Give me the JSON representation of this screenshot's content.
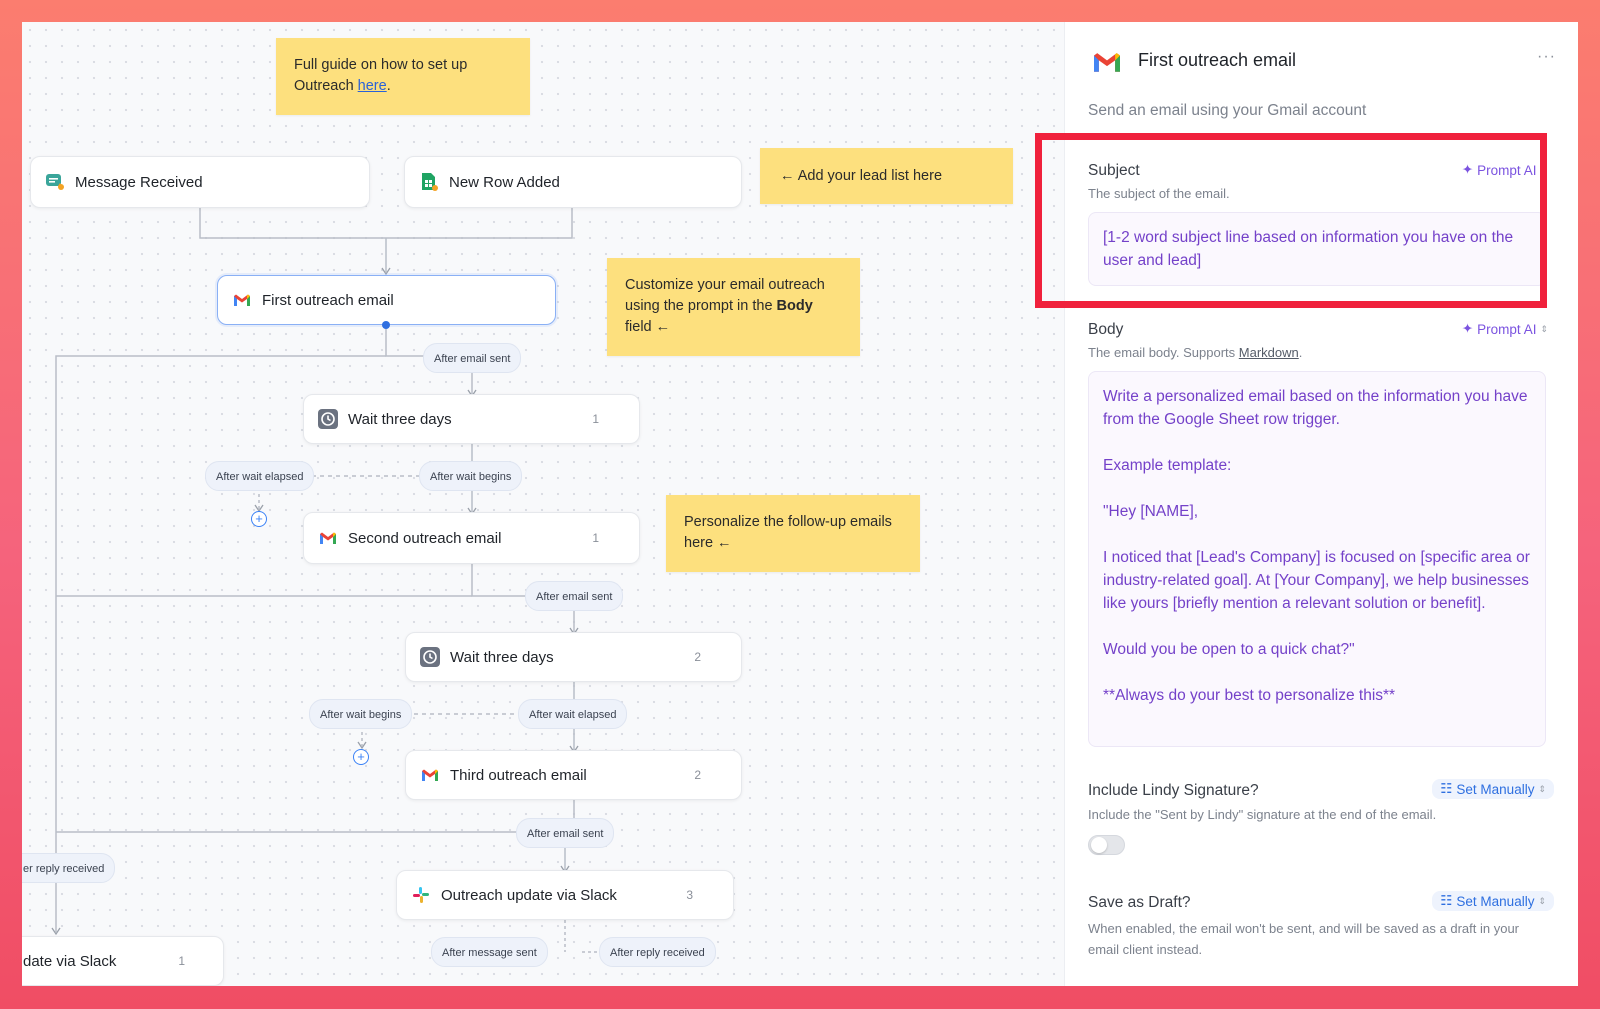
{
  "canvas": {
    "notes": {
      "guide_text": "Full guide on how to set up Outreach ",
      "guide_link": "here",
      "guide_period": ".",
      "lead_list": "← Add your lead list here",
      "customize_a": "Customize your email outreach using the prompt in the ",
      "customize_bold": "Body",
      "customize_b": " field ←",
      "personalize": "Personalize the follow-up emails here ←"
    },
    "nodes": {
      "message_received": {
        "label": "Message Received"
      },
      "new_row_added": {
        "label": "New Row Added"
      },
      "first_email": {
        "label": "First outreach email"
      },
      "wait1": {
        "label": "Wait three days",
        "count": "1"
      },
      "second_email": {
        "label": "Second outreach email",
        "count": "1"
      },
      "wait2": {
        "label": "Wait three days",
        "count": "2"
      },
      "third_email": {
        "label": "Third outreach email",
        "count": "2"
      },
      "slack": {
        "label": "Outreach update via Slack",
        "count": "3"
      },
      "slack_left": {
        "label": "date via Slack",
        "count": "1"
      }
    },
    "pills": {
      "after_email_sent_1": "After email sent",
      "after_wait_elapsed_1": "After wait elapsed",
      "after_wait_begins_1": "After wait begins",
      "after_email_sent_2": "After email sent",
      "after_wait_begins_2": "After wait begins",
      "after_wait_elapsed_2": "After wait elapsed",
      "after_email_sent_3": "After email sent",
      "reply_received_left": "er reply received",
      "after_message_sent": "After message sent",
      "after_reply_received": "After reply received"
    }
  },
  "panel": {
    "title": "First outreach email",
    "subtitle": "Send an email using your Gmail account",
    "menu": "···",
    "subject": {
      "title": "Subject",
      "desc": "The subject of the email.",
      "mode": "Prompt AI",
      "value": "[1-2 word subject line based on information you have on the user and lead]"
    },
    "body": {
      "title": "Body",
      "desc_prefix": "The email body. Supports ",
      "desc_link": "Markdown",
      "desc_suffix": ".",
      "mode": "Prompt AI",
      "value": "Write a personalized email based on the information you have from the Google Sheet row trigger.\n\nExample template:\n\n\"Hey [NAME],\n\nI noticed that [Lead's Company] is focused on [specific area or industry-related goal]. At [Your Company], we help businesses like yours [briefly mention a relevant solution or benefit].\n\nWould you be open to a quick chat?\"\n\n**Always do your best to personalize this**"
    },
    "signature": {
      "title": "Include Lindy Signature?",
      "desc": "Include the \"Sent by Lindy\" signature at the end of the email.",
      "mode": "Set Manually",
      "enabled": false
    },
    "draft": {
      "title": "Save as Draft?",
      "desc": "When enabled, the email won't be sent, and will be saved as a draft in your email client instead.",
      "mode": "Set Manually"
    }
  },
  "colors": {
    "accent": "#2f6fe0",
    "prompt": "#7b53e0",
    "note": "#fde07e",
    "highlight": "#f0213c"
  }
}
